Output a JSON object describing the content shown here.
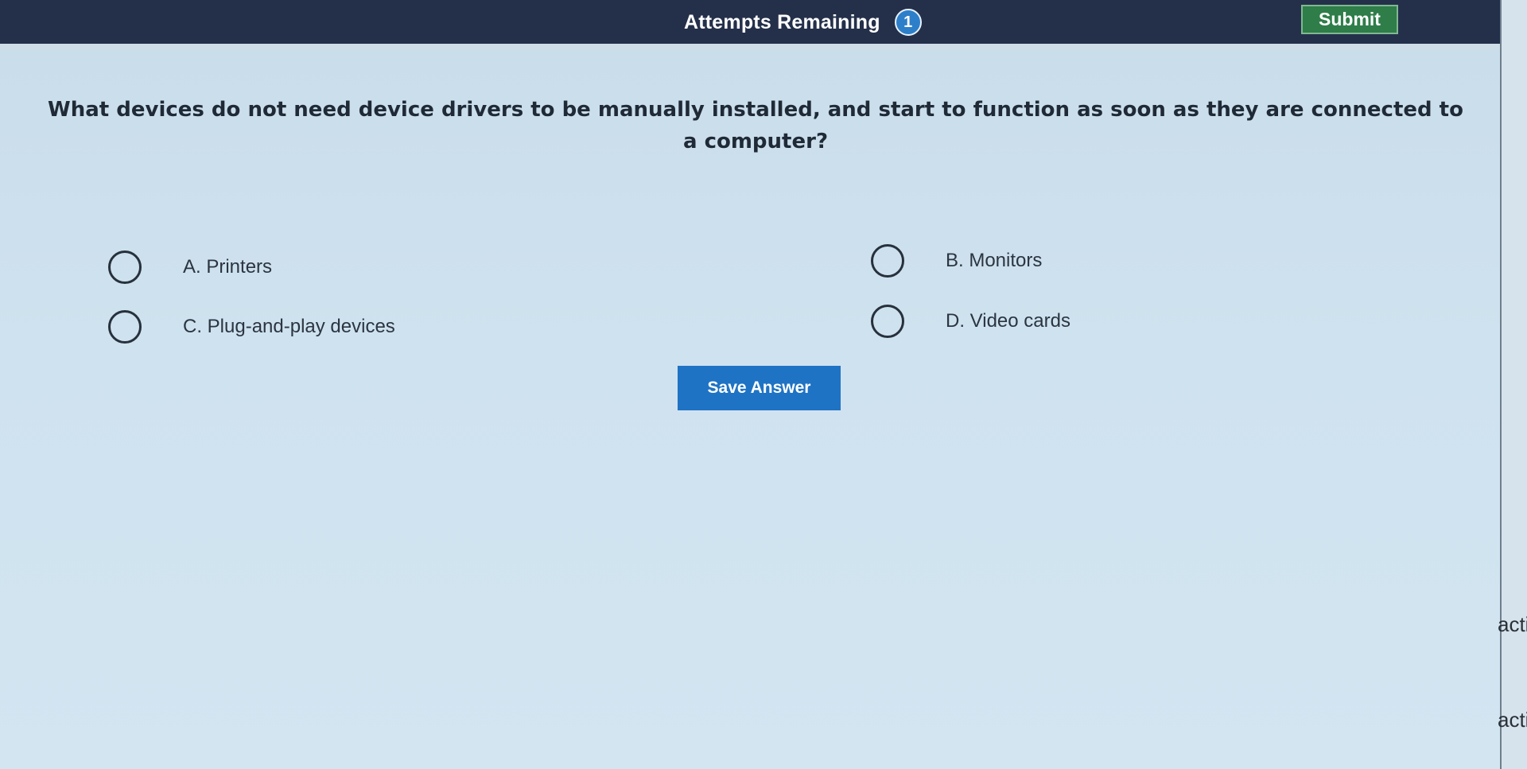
{
  "header": {
    "attempts_label": "Attempts Remaining",
    "attempts_count": "1",
    "submit_label": "Submit"
  },
  "question": {
    "text": "What devices do not need device drivers to be manually installed, and start to function as soon as they are connected to a computer?"
  },
  "options": [
    {
      "label": "A. Printers"
    },
    {
      "label": "B. Monitors"
    },
    {
      "label": "C. Plug-and-play devices"
    },
    {
      "label": "D. Video cards"
    }
  ],
  "save_label": "Save Answer",
  "side_text": [
    "acti",
    "acti"
  ],
  "colors": {
    "header_bg": "#24304a",
    "submit_bg": "#2f7d49",
    "badge_bg": "#2d7fc9",
    "save_bg": "#1f73c4",
    "page_bg": "#cfe2ef"
  }
}
